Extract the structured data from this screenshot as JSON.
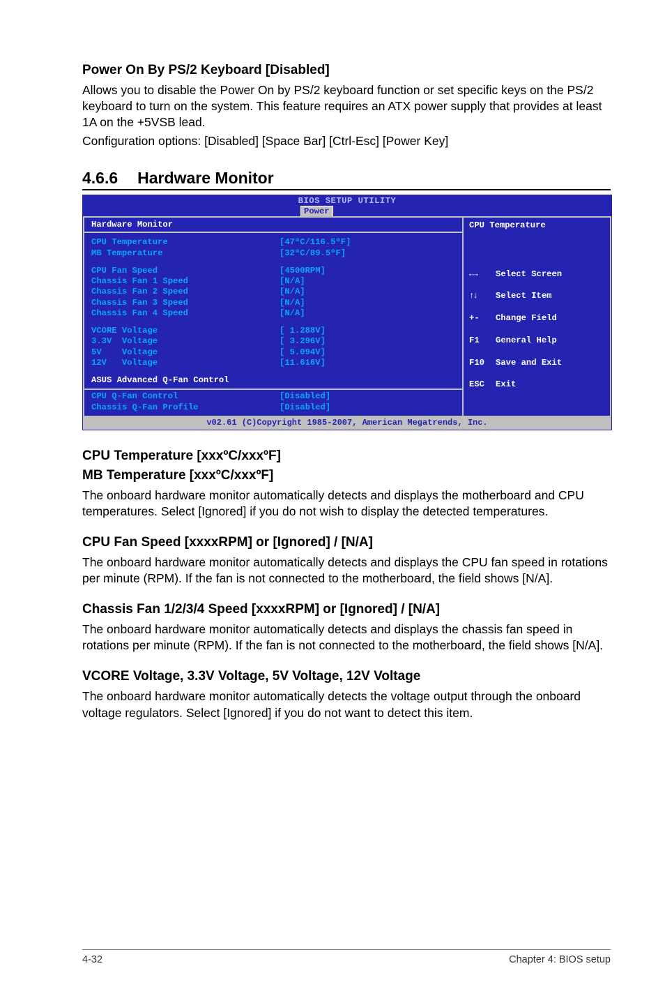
{
  "sec1": {
    "heading": "Power On By PS/2 Keyboard [Disabled]",
    "p1": "Allows you to disable the Power On by PS/2 keyboard function or set specific keys on the PS/2 keyboard to turn on the system. This feature requires an ATX power supply that provides at least 1A on the +5VSB lead.",
    "p2": "Configuration options: [Disabled] [Space Bar] [Ctrl-Esc] [Power Key]"
  },
  "h2": {
    "num": "4.6.6",
    "title": "Hardware Monitor"
  },
  "bios": {
    "title": "BIOS SETUP UTILITY",
    "tab": "Power",
    "panel_header": "Hardware Monitor",
    "help_title": "CPU Temperature",
    "rows_a": [
      {
        "label": "CPU Temperature",
        "value": "[47ºC/116.5ºF]"
      },
      {
        "label": "MB Temperature",
        "value": "[32ºC/89.5ºF]"
      }
    ],
    "rows_b": [
      {
        "label": "CPU Fan Speed",
        "value": "[4500RPM]"
      },
      {
        "label": "Chassis Fan 1 Speed",
        "value": "[N/A]"
      },
      {
        "label": "Chassis Fan 2 Speed",
        "value": "[N/A]"
      },
      {
        "label": "Chassis Fan 3 Speed",
        "value": "[N/A]"
      },
      {
        "label": "Chassis Fan 4 Speed",
        "value": "[N/A]"
      }
    ],
    "rows_c": [
      {
        "label": "VCORE Voltage",
        "value": "[ 1.288V]"
      },
      {
        "label": "3.3V  Voltage",
        "value": "[ 3.296V]"
      },
      {
        "label": "5V    Voltage",
        "value": "[ 5.094V]"
      },
      {
        "label": "12V   Voltage",
        "value": "[11.616V]"
      }
    ],
    "adv_label": "ASUS Advanced Q-Fan Control",
    "rows_d": [
      {
        "label": "CPU Q-Fan Control",
        "value": "[Disabled]"
      },
      {
        "label": "Chassis Q-Fan Profile",
        "value": "[Disabled]"
      }
    ],
    "legend": [
      {
        "k": "←→",
        "t": "Select Screen"
      },
      {
        "k": "↑↓",
        "t": "Select Item"
      },
      {
        "k": "+-",
        "t": "Change Field"
      },
      {
        "k": "F1",
        "t": "General Help"
      },
      {
        "k": "F10",
        "t": "Save and Exit"
      },
      {
        "k": "ESC",
        "t": "Exit"
      }
    ],
    "footer": "v02.61 (C)Copyright 1985-2007, American Megatrends, Inc."
  },
  "sec_cpu": {
    "h1": "CPU Temperature [xxxºC/xxxºF]",
    "h2": "MB Temperature [xxxºC/xxxºF]",
    "p": "The onboard hardware monitor automatically detects and displays the motherboard and CPU temperatures. Select [Ignored] if you do not wish to display the detected temperatures."
  },
  "sec_cpufan": {
    "h": "CPU Fan Speed [xxxxRPM] or [Ignored] / [N/A]",
    "p": "The onboard hardware monitor automatically detects and displays the CPU fan speed in rotations per minute (RPM). If the fan is not connected to the motherboard, the field shows [N/A]."
  },
  "sec_chassis": {
    "h": "Chassis Fan 1/2/3/4 Speed [xxxxRPM] or [Ignored] / [N/A]",
    "p": "The onboard hardware monitor automatically detects and displays the chassis fan speed in rotations per minute (RPM). If the fan is not connected to the motherboard, the field shows [N/A]."
  },
  "sec_volt": {
    "h": "VCORE Voltage, 3.3V Voltage, 5V Voltage, 12V Voltage",
    "p": "The onboard hardware monitor automatically detects the voltage output through the onboard voltage regulators. Select [Ignored] if you do not want to detect this item."
  },
  "footer": {
    "left": "4-32",
    "right": "Chapter 4: BIOS setup"
  }
}
